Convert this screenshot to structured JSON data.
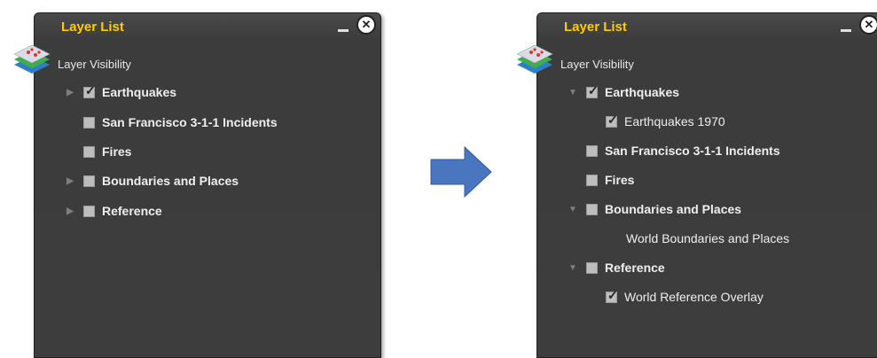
{
  "left_panel": {
    "title": "Layer List",
    "close_glyph": "✕",
    "subtitle": "Layer Visibility",
    "layers": [
      {
        "label": "Earthquakes",
        "checked": true,
        "expandable": true
      },
      {
        "label": "San Francisco 3-1-1 Incidents",
        "checked": false,
        "expandable": false
      },
      {
        "label": "Fires",
        "checked": false,
        "expandable": false
      },
      {
        "label": "Boundaries and Places",
        "checked": false,
        "expandable": true
      },
      {
        "label": "Reference",
        "checked": false,
        "expandable": true
      }
    ]
  },
  "right_panel": {
    "title": "Layer List",
    "close_glyph": "✕",
    "subtitle": "Layer Visibility",
    "layers": [
      {
        "label": "Earthquakes",
        "checked": true,
        "expanded": true
      },
      {
        "label": "Earthquakes 1970",
        "checked": true,
        "sublayer": true
      },
      {
        "label": "San Francisco 3-1-1 Incidents",
        "checked": false
      },
      {
        "label": "Fires",
        "checked": false
      },
      {
        "label": "Boundaries and Places",
        "checked": false,
        "expanded": true
      },
      {
        "label": "World Boundaries and Places",
        "sublayer": true,
        "no_checkbox": true
      },
      {
        "label": "Reference",
        "checked": false,
        "expanded": true
      },
      {
        "label": "World Reference Overlay",
        "checked": true,
        "sublayer": true
      }
    ]
  },
  "colors": {
    "panel_bg": "#3d3d3d",
    "title": "#ffcc00",
    "text": "#eeeeee",
    "arrow": "#4a76c0"
  },
  "icons": {
    "layer_stack": "layer-stack-icon",
    "arrow": "right-arrow-icon",
    "close": "close-icon",
    "minimize": "minimize-icon"
  }
}
